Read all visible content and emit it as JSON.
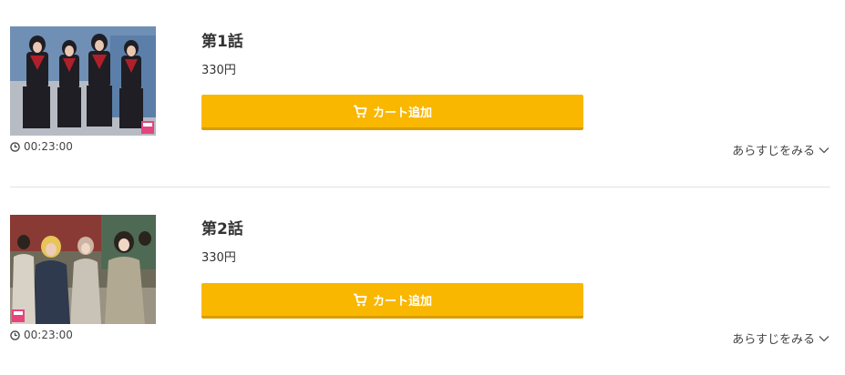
{
  "episodes": [
    {
      "title": "第1話",
      "price": "330円",
      "duration": "00:23:00",
      "cart_label": "カート追加",
      "synopsis_label": "あらすじをみる"
    },
    {
      "title": "第2話",
      "price": "330円",
      "duration": "00:23:00",
      "cart_label": "カート追加",
      "synopsis_label": "あらすじをみる"
    }
  ],
  "icons": {
    "clock": "clock-icon",
    "cart": "cart-icon",
    "chevron": "chevron-down-icon"
  },
  "colors": {
    "cart_button": "#f9b700",
    "cart_button_border": "#d99d00",
    "text": "#333333",
    "divider": "#e3e3e3"
  }
}
